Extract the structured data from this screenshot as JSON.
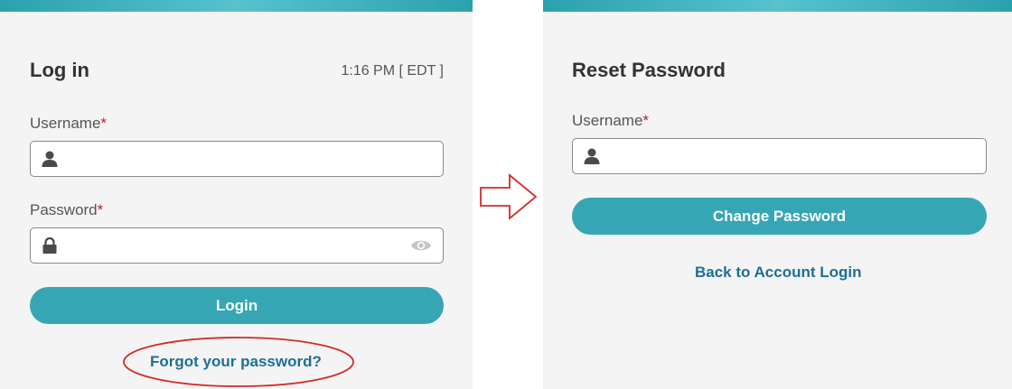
{
  "login": {
    "title": "Log in",
    "time": "1:16 PM [ EDT ]",
    "username_label": "Username",
    "password_label": "Password",
    "required_mark": "*",
    "username_value": "",
    "password_value": "",
    "login_button": "Login",
    "forgot_link": "Forgot your password?"
  },
  "reset": {
    "title": "Reset Password",
    "username_label": "Username",
    "required_mark": "*",
    "username_value": "",
    "change_button": "Change Password",
    "back_link": "Back to Account Login"
  },
  "icons": {
    "username": "user-icon",
    "password": "lock-icon",
    "show_password": "eye-icon",
    "annotation_arrow": "arrow-right-icon"
  },
  "colors": {
    "accent": "#36a6b4",
    "top_bar": "#2aa2ad",
    "link": "#1d6f95",
    "required": "#b1272b",
    "annotation": "#d42a2a",
    "panel_bg": "#f4f4f4"
  }
}
